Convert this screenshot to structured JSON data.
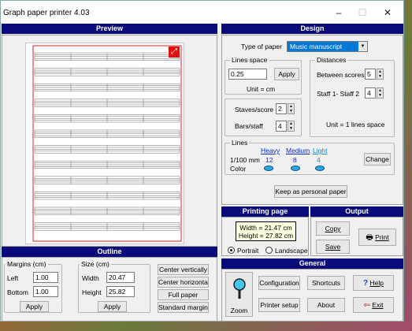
{
  "window": {
    "title": "Graph paper printer 4.03",
    "minimize": "–",
    "maximize": "☐",
    "close": "✕"
  },
  "preview": {
    "header": "Preview"
  },
  "design": {
    "header": "Design",
    "type_label": "Type of paper",
    "type_value": "Music manuscript",
    "lines_space": {
      "label": "Lines space",
      "value": "0.25",
      "apply": "Apply",
      "unit": "Unit = cm"
    },
    "distances": {
      "label": "Distances",
      "between_label": "Between scores",
      "between_value": "5",
      "staff_label": "Staff 1- Staff 2",
      "staff_value": "4",
      "unit": "Unit = 1 lines space"
    },
    "staves_label": "Staves/score",
    "staves_value": "2",
    "bars_label": "Bars/staff",
    "bars_value": "4",
    "lines": {
      "label": "Lines",
      "heavy": "Heavy",
      "medium": "Medium",
      "light": "Light",
      "row1_label": "1/100 mm",
      "heavy_val": "12",
      "medium_val": "8",
      "light_val": "4",
      "row2_label": "Color",
      "change": "Change"
    },
    "keep_button": "Keep as personal paper"
  },
  "printing": {
    "header": "Printing page",
    "width_text": "Width = 21.47 cm",
    "height_text": "Height = 27.82 cm",
    "portrait": "Portrait",
    "landscape": "Landscape"
  },
  "output": {
    "header": "Output",
    "copy": "Copy",
    "save": "Save",
    "print": "Print"
  },
  "outline": {
    "header": "Outline",
    "margins_label": "Margins (cm)",
    "left_label": "Left",
    "left_value": "1.00",
    "bottom_label": "Bottom",
    "bottom_value": "1.00",
    "margins_apply": "Apply",
    "size_label": "Size (cm)",
    "width_label": "Width",
    "width_value": "20.47",
    "height_label": "Height",
    "height_value": "25.82",
    "size_apply": "Apply",
    "center_v": "Center vertically",
    "center_h": "Center horizontally",
    "full_paper": "Full paper",
    "standard_margins": "Standard margins"
  },
  "general": {
    "header": "General",
    "zoom": "Zoom",
    "configuration": "Configuration",
    "shortcuts": "Shortcuts",
    "help": "Help",
    "printer_setup": "Printer setup",
    "about": "About",
    "exit": "Exit"
  }
}
